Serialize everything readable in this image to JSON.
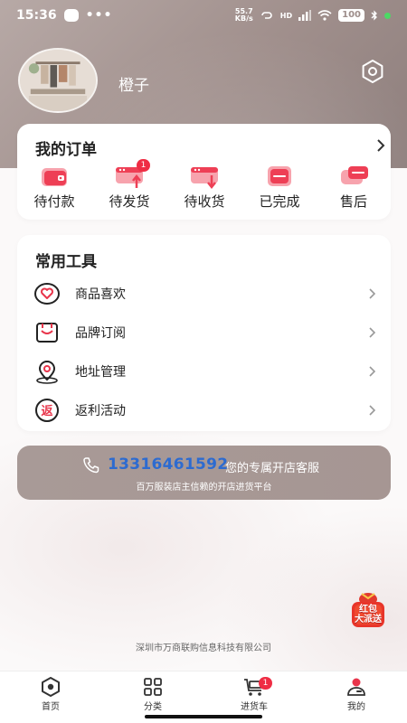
{
  "status_bar": {
    "time": "15:36",
    "dots": "•••",
    "net_speed_value": "55.7",
    "net_speed_unit": "KB/s",
    "signal": "HD",
    "battery": "100"
  },
  "profile": {
    "username": "橙子"
  },
  "orders": {
    "title": "我的订单",
    "items": [
      {
        "label": "待付款",
        "icon": "wallet-icon",
        "badge": ""
      },
      {
        "label": "待发货",
        "icon": "ship-out-icon",
        "badge": "1"
      },
      {
        "label": "待收货",
        "icon": "receive-icon",
        "badge": ""
      },
      {
        "label": "已完成",
        "icon": "completed-icon",
        "badge": ""
      },
      {
        "label": "售后",
        "icon": "after-sale-icon",
        "badge": ""
      }
    ]
  },
  "tools": {
    "title": "常用工具",
    "items": [
      {
        "label": "商品喜欢",
        "icon": "heart-icon"
      },
      {
        "label": "品牌订阅",
        "icon": "subscribe-icon"
      },
      {
        "label": "地址管理",
        "icon": "location-icon"
      },
      {
        "label": "返利活动",
        "icon": "rebate-icon",
        "icon_text": "返"
      }
    ]
  },
  "service": {
    "phone": "13316461592",
    "label": "您的专属开店客服",
    "subtitle": "百万服装店主信赖的开店进货平台"
  },
  "red_envelope": {
    "line1": "红包",
    "line2": "大派送"
  },
  "footer": {
    "company": "深圳市万商联购信息科技有限公司"
  },
  "nav": {
    "items": [
      {
        "label": "首页",
        "icon": "home-icon"
      },
      {
        "label": "分类",
        "icon": "category-icon"
      },
      {
        "label": "进货车",
        "icon": "cart-icon",
        "badge": "1"
      },
      {
        "label": "我的",
        "icon": "profile-icon"
      }
    ]
  },
  "colors": {
    "accent": "#e8354b",
    "hero": "#a89a97",
    "phone": "#2d6bd0"
  }
}
